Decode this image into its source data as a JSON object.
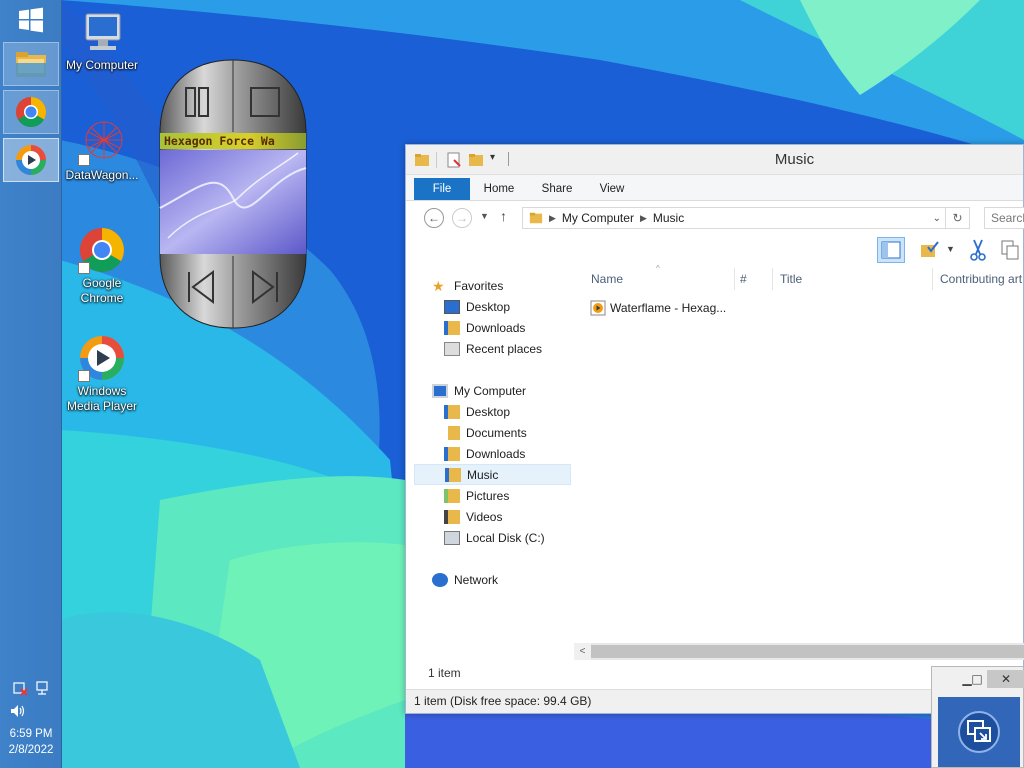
{
  "desktop": {
    "icons": [
      {
        "label": "My Computer"
      },
      {
        "label": "DataWagon..."
      },
      {
        "label": "Google Chrome"
      },
      {
        "label": "Windows Media Player"
      }
    ]
  },
  "taskbar": {
    "tray": {
      "time": "6:59 PM",
      "date": "2/8/2022"
    }
  },
  "media_player": {
    "track_title": "Hexagon Force  Wa"
  },
  "explorer": {
    "title": "Music",
    "ribbon_tabs": [
      "File",
      "Home",
      "Share",
      "View"
    ],
    "address": {
      "part1": "My Computer",
      "part2": "Music"
    },
    "search_placeholder": "Search",
    "nav": {
      "favorites": "Favorites",
      "fav_items": [
        "Desktop",
        "Downloads",
        "Recent places"
      ],
      "computer": "My Computer",
      "computer_items": [
        "Desktop",
        "Documents",
        "Downloads",
        "Music",
        "Pictures",
        "Videos",
        "Local Disk (C:)"
      ],
      "network": "Network"
    },
    "columns": {
      "name": "Name",
      "number": "#",
      "title": "Title",
      "artist": "Contributing art"
    },
    "files": [
      {
        "name": "Waterflame - Hexag..."
      }
    ],
    "item_count": "1 item",
    "status": "1 item (Disk free space: 99.4 GB)"
  },
  "colors": {
    "ribbon_file_tab": "#1a73c4",
    "selected_nav": "#e5f1fb",
    "taskbar": "#3f82c9"
  }
}
